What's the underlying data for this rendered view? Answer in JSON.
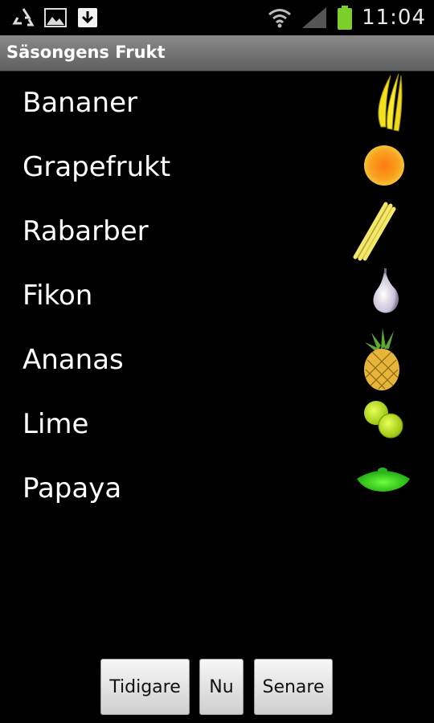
{
  "status_bar": {
    "time": "11:04",
    "icons": [
      "recycle-icon",
      "image-icon",
      "download-icon",
      "wifi-icon",
      "signal-icon",
      "battery-icon"
    ],
    "battery_color": "#7ccf2a"
  },
  "app": {
    "title": "Säsongens Frukt"
  },
  "fruits": [
    {
      "label": "Bananer",
      "icon": "banana-icon",
      "color": "#f2e21b"
    },
    {
      "label": "Grapefrukt",
      "icon": "grapefruit-icon",
      "color": "#f7a51e"
    },
    {
      "label": "Rabarber",
      "icon": "rhubarb-icon",
      "color": "#f4e86a"
    },
    {
      "label": "Fikon",
      "icon": "fig-icon",
      "color": "#d8d2e0"
    },
    {
      "label": "Ananas",
      "icon": "pineapple-icon",
      "color": "#e6b53a"
    },
    {
      "label": "Lime",
      "icon": "lime-icon",
      "color": "#c8e61e"
    },
    {
      "label": "Papaya",
      "icon": "papaya-icon",
      "color": "#3ad21c"
    }
  ],
  "buttons": {
    "previous": "Tidigare",
    "now": "Nu",
    "next": "Senare"
  }
}
